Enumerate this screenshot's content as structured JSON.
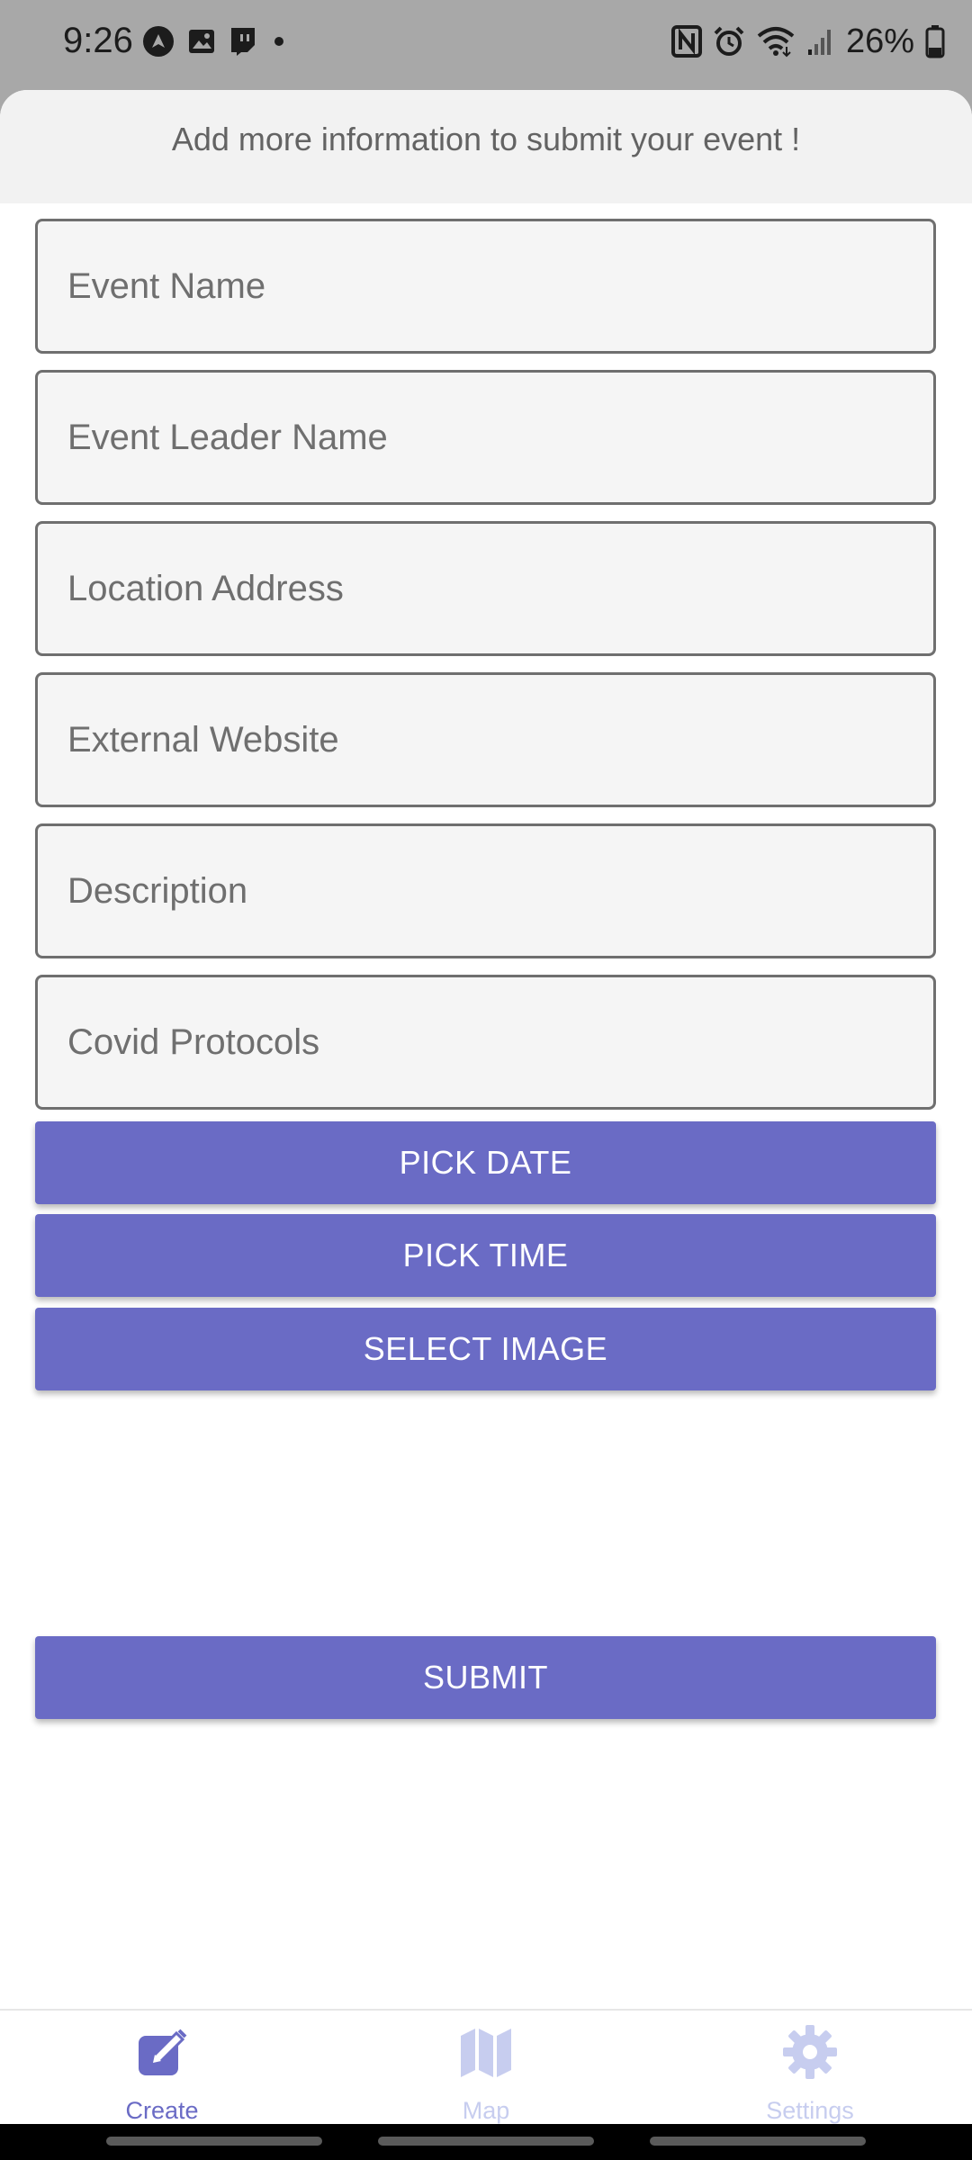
{
  "status_bar": {
    "time": "9:26",
    "battery": "26%",
    "left_icons": [
      "navigation-icon",
      "image-icon",
      "twitch-icon",
      "dot-icon"
    ],
    "right_icons": [
      "nfc-icon",
      "alarm-icon",
      "wifi-icon",
      "signal-icon",
      "battery-icon"
    ]
  },
  "sheet": {
    "title": "Add more information to submit your event !"
  },
  "form": {
    "fields": [
      {
        "placeholder": "Event Name",
        "value": ""
      },
      {
        "placeholder": "Event Leader Name",
        "value": ""
      },
      {
        "placeholder": "Location Address",
        "value": ""
      },
      {
        "placeholder": "External Website",
        "value": ""
      },
      {
        "placeholder": "Description",
        "value": ""
      },
      {
        "placeholder": "Covid Protocols",
        "value": ""
      }
    ],
    "pick_date_label": "PICK DATE",
    "pick_time_label": "PICK TIME",
    "select_image_label": "SELECT IMAGE",
    "submit_label": "SUBMIT"
  },
  "tabs": [
    {
      "label": "Create",
      "icon": "pencil-icon",
      "active": true
    },
    {
      "label": "Map",
      "icon": "map-icon",
      "active": false
    },
    {
      "label": "Settings",
      "icon": "gear-icon",
      "active": false
    }
  ],
  "colors": {
    "accent": "#6a6bc5",
    "tab_inactive": "#c7cdef",
    "field_border": "#6f6f6f",
    "field_bg": "#f5f5f5",
    "status_bar_bg": "#a8a8a8"
  }
}
